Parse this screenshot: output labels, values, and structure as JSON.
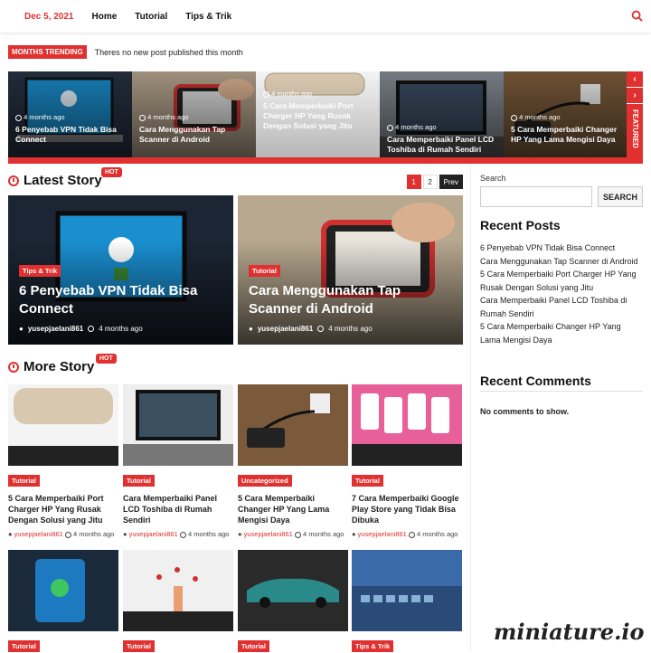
{
  "topbar": {
    "date": "Dec 5, 2021",
    "nav": [
      "Home",
      "Tutorial",
      "Tips & Trik"
    ]
  },
  "trending": {
    "badge": "MONTHS TRENDING",
    "text": "Theres no new post published this month"
  },
  "slider": {
    "featured_label": "FEATURED",
    "prev_arrow": "‹",
    "next_arrow": "›",
    "slides": [
      {
        "meta": "4 months ago",
        "title": "6 Penyebab VPN Tidak Bisa Connect"
      },
      {
        "meta": "4 months ago",
        "title": "Cara Menggunakan Tap Scanner di Android"
      },
      {
        "meta": "4 months ago",
        "title": "5 Cara Memperbaiki Port Charger HP Yang Rusak Dengan Solusi yang Jitu"
      },
      {
        "meta": "4 months ago",
        "title": "Cara Memperbaiki Panel LCD Toshiba di Rumah Sendiri"
      },
      {
        "meta": "4 months ago",
        "title": "5 Cara Memperbaiki Changer HP Yang Lama Mengisi Daya"
      }
    ]
  },
  "latest": {
    "heading": "Latest Story",
    "hot": "HOT",
    "pager": [
      "1",
      "2",
      "Prev"
    ],
    "posts": [
      {
        "category": "Tips & Trik",
        "title": "6 Penyebab VPN Tidak Bisa Connect",
        "author": "yusepjaelani861",
        "time": "4 months ago"
      },
      {
        "category": "Tutorial",
        "title": "Cara Menggunakan Tap Scanner di Android",
        "author": "yusepjaelani861",
        "time": "4 months ago"
      }
    ]
  },
  "more": {
    "heading": "More Story",
    "hot": "HOT",
    "cards": [
      {
        "category": "Tutorial",
        "title": "5 Cara Memperbaiki Port Charger HP Yang Rusak Dengan Solusi yang Jitu",
        "author": "yusepjaelani861",
        "time": "4 months ago"
      },
      {
        "category": "Tutorial",
        "title": "Cara Memperbaiki Panel LCD Toshiba di Rumah Sendiri",
        "author": "yusepjaelani861",
        "time": "4 months ago"
      },
      {
        "category": "Uncategorized",
        "title": "5 Cara Memperbaiki Changer HP Yang Lama Mengisi Daya",
        "author": "yusepjaelani861",
        "time": "4 months ago"
      },
      {
        "category": "Tutorial",
        "title": "7 Cara Memperbaiki Google Play Store yang Tidak Bisa Dibuka",
        "author": "yusepjaelani861",
        "time": "4 months ago"
      }
    ],
    "row2_categories": [
      "Tutorial",
      "Tutorial",
      "Tutorial",
      "Tips & Trik"
    ]
  },
  "sidebar": {
    "search_label": "Search",
    "search_button": "SEARCH",
    "recent_posts_heading": "Recent Posts",
    "recent_posts": [
      "6 Penyebab VPN Tidak Bisa Connect",
      "Cara Menggunakan Tap Scanner di Android",
      "5 Cara Memperbaiki Port Charger HP Yang Rusak Dengan Solusi yang Jitu",
      "Cara Memperbaiki Panel LCD Toshiba di Rumah Sendiri",
      "5 Cara Memperbaiki Changer HP Yang Lama Mengisi Daya"
    ],
    "recent_comments_heading": "Recent Comments",
    "no_comments": "No comments to show."
  },
  "watermark": "miniature.io",
  "colors": {
    "accent": "#e03030"
  }
}
